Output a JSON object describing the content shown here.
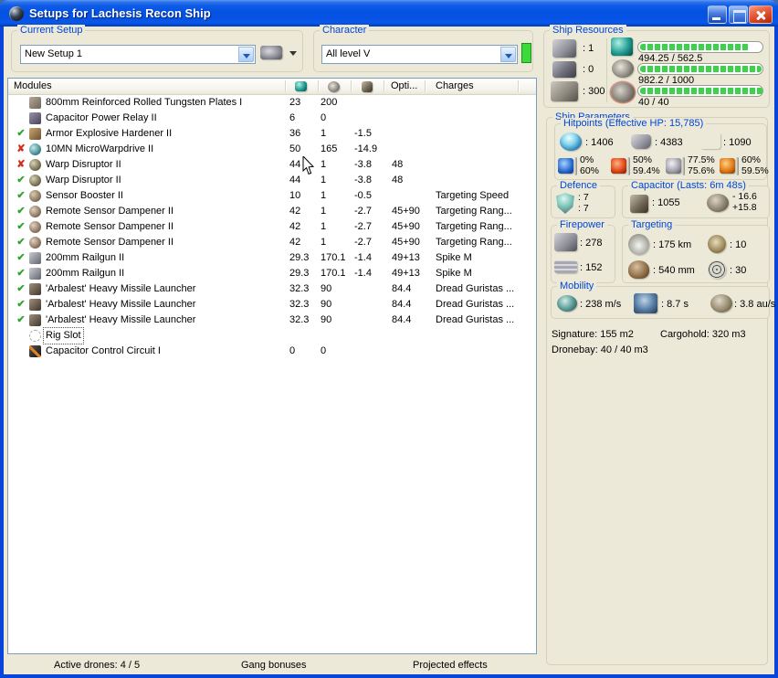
{
  "window": {
    "title": "Setups for Lachesis Recon Ship"
  },
  "setup": {
    "label": "Current Setup",
    "value": "New Setup 1"
  },
  "character": {
    "label": "Character",
    "value": "All level V"
  },
  "modules": {
    "columns": {
      "modules": "Modules",
      "opti": "Opti...",
      "charges": "Charges"
    },
    "rows": [
      {
        "state": "none",
        "icon": "armor-plate",
        "name": "800mm Reinforced Rolled Tungsten Plates I",
        "cpu": "23",
        "pg": "200",
        "cap": "",
        "opti": "",
        "charge": ""
      },
      {
        "state": "none",
        "icon": "cap-relay",
        "name": "Capacitor Power Relay II",
        "cpu": "6",
        "pg": "0",
        "cap": "",
        "opti": "",
        "charge": ""
      },
      {
        "state": "on",
        "icon": "armor-hardener",
        "name": "Armor Explosive Hardener II",
        "cpu": "36",
        "pg": "1",
        "cap": "-1.5",
        "opti": "",
        "charge": ""
      },
      {
        "state": "off",
        "icon": "mwd",
        "name": "10MN MicroWarpdrive II",
        "cpu": "50",
        "pg": "165",
        "cap": "-14.9",
        "opti": "",
        "charge": ""
      },
      {
        "state": "off",
        "icon": "warp-disruptor",
        "name": "Warp Disruptor II",
        "cpu": "44",
        "pg": "1",
        "cap": "-3.8",
        "opti": "48",
        "charge": ""
      },
      {
        "state": "on",
        "icon": "warp-disruptor",
        "name": "Warp Disruptor II",
        "cpu": "44",
        "pg": "1",
        "cap": "-3.8",
        "opti": "48",
        "charge": ""
      },
      {
        "state": "on",
        "icon": "sensor-booster",
        "name": "Sensor Booster II",
        "cpu": "10",
        "pg": "1",
        "cap": "-0.5",
        "opti": "",
        "charge": "Targeting Speed"
      },
      {
        "state": "on",
        "icon": "sensor-dampener",
        "name": "Remote Sensor Dampener II",
        "cpu": "42",
        "pg": "1",
        "cap": "-2.7",
        "opti": "45+90",
        "charge": "Targeting Rang..."
      },
      {
        "state": "on",
        "icon": "sensor-dampener",
        "name": "Remote Sensor Dampener II",
        "cpu": "42",
        "pg": "1",
        "cap": "-2.7",
        "opti": "45+90",
        "charge": "Targeting Rang..."
      },
      {
        "state": "on",
        "icon": "sensor-dampener",
        "name": "Remote Sensor Dampener II",
        "cpu": "42",
        "pg": "1",
        "cap": "-2.7",
        "opti": "45+90",
        "charge": "Targeting Rang..."
      },
      {
        "state": "on",
        "icon": "railgun",
        "name": "200mm Railgun II",
        "cpu": "29.3",
        "pg": "170.1",
        "cap": "-1.4",
        "opti": "49+13",
        "charge": "Spike M"
      },
      {
        "state": "on",
        "icon": "railgun",
        "name": "200mm Railgun II",
        "cpu": "29.3",
        "pg": "170.1",
        "cap": "-1.4",
        "opti": "49+13",
        "charge": "Spike M"
      },
      {
        "state": "on",
        "icon": "missile-launcher",
        "name": "'Arbalest' Heavy Missile Launcher",
        "cpu": "32.3",
        "pg": "90",
        "cap": "",
        "opti": "84.4",
        "charge": "Dread Guristas ..."
      },
      {
        "state": "on",
        "icon": "missile-launcher",
        "name": "'Arbalest' Heavy Missile Launcher",
        "cpu": "32.3",
        "pg": "90",
        "cap": "",
        "opti": "84.4",
        "charge": "Dread Guristas ..."
      },
      {
        "state": "on",
        "icon": "missile-launcher",
        "name": "'Arbalest' Heavy Missile Launcher",
        "cpu": "32.3",
        "pg": "90",
        "cap": "",
        "opti": "84.4",
        "charge": "Dread Guristas ..."
      },
      {
        "state": "empty",
        "icon": "rig-slot",
        "name": "Rig Slot",
        "cpu": "",
        "pg": "",
        "cap": "",
        "opti": "",
        "charge": "",
        "focused": true
      },
      {
        "state": "none",
        "icon": "ccc",
        "name": "Capacitor Control Circuit I",
        "cpu": "0",
        "pg": "0",
        "cap": "",
        "opti": "",
        "charge": ""
      }
    ]
  },
  "ship_resources": {
    "label": "Ship Resources",
    "turrets": ": 1",
    "launchers": ": 0",
    "hardware": ": 300",
    "cpu": {
      "text": "494.25 / 562.5",
      "pct": 88
    },
    "powergrid": {
      "text": "982.2 / 1000",
      "pct": 98
    },
    "calibration": {
      "text": "40 / 40",
      "pct": 100
    }
  },
  "ship_parameters": {
    "label": "Ship Parameters",
    "hitpoints": {
      "label": "Hitpoints (Effective HP: 15,785)",
      "shield": ": 1406",
      "armor": ": 4383",
      "hull": ": 1090",
      "resists": [
        {
          "type": "em",
          "shield": "0%",
          "armor": "60%"
        },
        {
          "type": "thermal",
          "shield": "50%",
          "armor": "59.4%"
        },
        {
          "type": "kinetic",
          "shield": "77.5%",
          "armor": "75.6%"
        },
        {
          "type": "explosive",
          "shield": "60%",
          "armor": "59.5%"
        }
      ]
    },
    "defence": {
      "label": "Defence",
      "top": ": 7",
      "bottom": ": 7"
    },
    "capacitor": {
      "label": "Capacitor (Lasts: 6m 48s)",
      "amount": ": 1055",
      "drain": "- 16.6",
      "recharge": "+15.8"
    },
    "firepower": {
      "label": "Firepower",
      "turret": ": 278",
      "missile": ": 152"
    },
    "targeting": {
      "label": "Targeting",
      "range": ": 175 km",
      "scan_res": ": 540 mm",
      "max_targets": ": 10",
      "sensor_strength": ": 30"
    },
    "mobility": {
      "label": "Mobility",
      "speed": ": 238 m/s",
      "agility": ": 8.7 s",
      "warp_speed": ": 3.8 au/s"
    },
    "stats": {
      "signature": "Signature: 155 m2",
      "cargohold": "Cargohold: 320 m3",
      "dronebay": "Dronebay: 40 / 40 m3"
    }
  },
  "footer": {
    "active_drones": "Active drones: 4 / 5",
    "gang_bonuses": "Gang bonuses",
    "projected_effects": "Projected effects"
  },
  "colors": {
    "titlebar_blue": "#0452E2",
    "client_bg": "#ECE9D8",
    "caption_blue": "#0046D5",
    "bar_green": "#3CD24C",
    "indicator_green": "#3ADB3A",
    "state_on_green": "#2FA52F",
    "state_off_red": "#D03020",
    "close_red": "#D8431F"
  }
}
